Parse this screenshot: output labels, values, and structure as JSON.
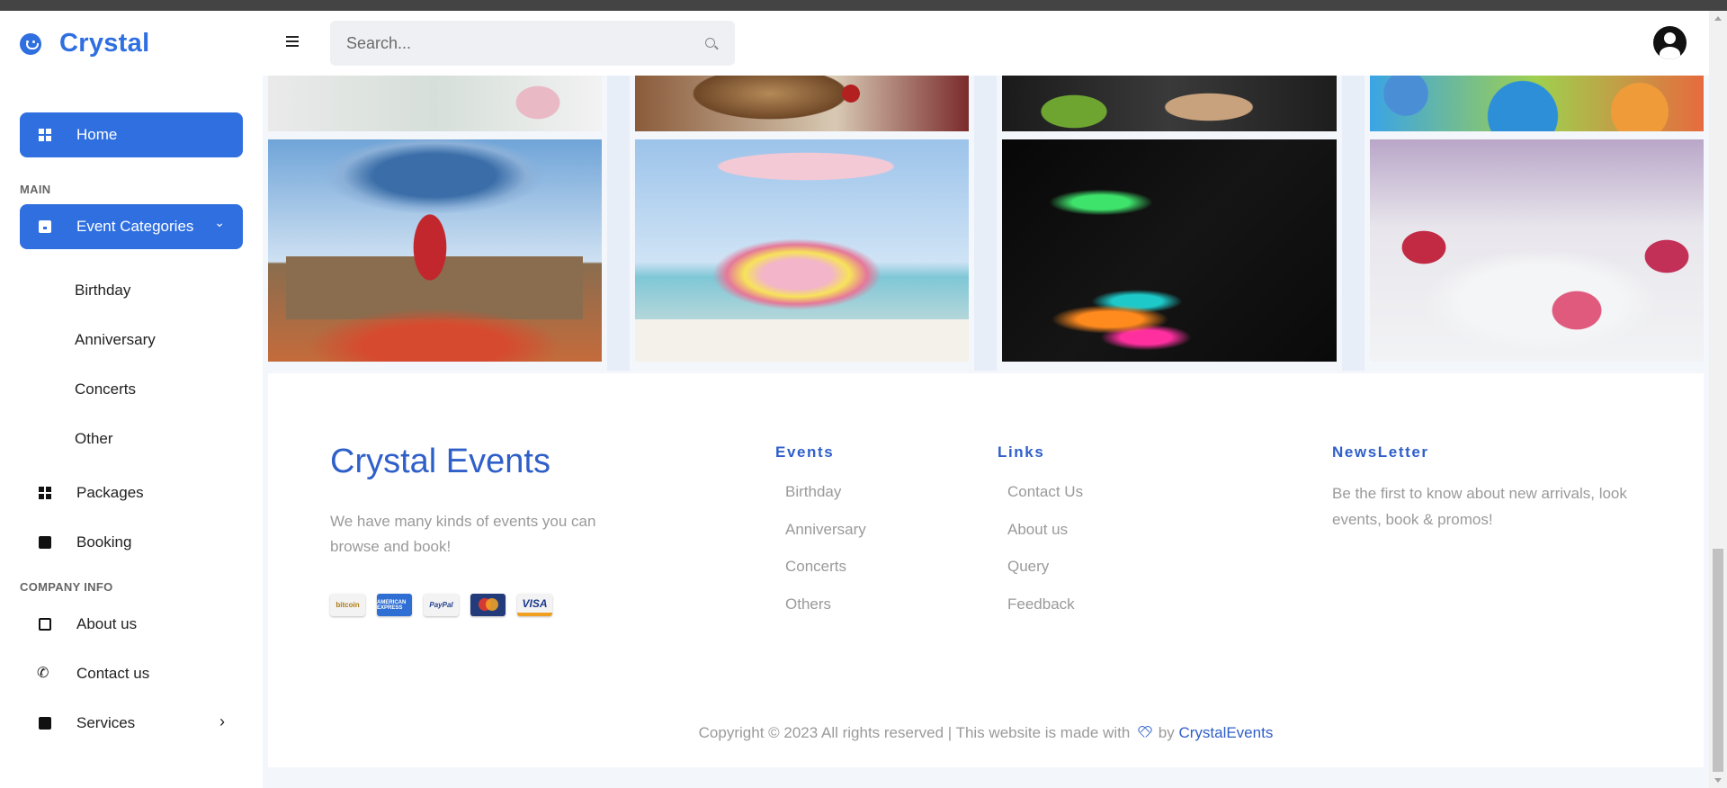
{
  "brand": {
    "name": "Crystal",
    "icon": "smile-icon",
    "color": "#2f6fe0"
  },
  "sidebar": {
    "home": {
      "label": "Home",
      "icon": "dashboard-icon"
    },
    "section_main": "MAIN",
    "event_categories": {
      "label": "Event Categories",
      "icon": "calendar-icon",
      "chevron": "⌄"
    },
    "sub_items": [
      "Birthday",
      "Anniversary",
      "Concerts",
      "Other"
    ],
    "packages": {
      "label": "Packages",
      "icon": "grid-icon"
    },
    "booking": {
      "label": "Booking",
      "icon": "chart-icon"
    },
    "section_company": "COMPANY INFO",
    "about": {
      "label": "About us",
      "icon": "info-box-icon"
    },
    "contact": {
      "label": "Contact us",
      "icon": "phone-icon"
    },
    "services": {
      "label": "Services",
      "icon": "clipboard-icon",
      "chevron": "›"
    }
  },
  "header": {
    "search_placeholder": "Search...",
    "search_value": ""
  },
  "footer": {
    "title": "Crystal Events",
    "description": "We have many kinds of events you can browse and book!",
    "payments": [
      "bitcoin",
      "AMERICAN EXPRESS",
      "PayPal",
      "MasterCard",
      "VISA"
    ],
    "events_heading": "Events",
    "events_links": [
      "Birthday",
      "Anniversary",
      "Concerts",
      "Others"
    ],
    "links_heading": "Links",
    "links": [
      "Contact Us",
      "About us",
      "Query",
      "Feedback"
    ],
    "newsletter_heading": "NewsLetter",
    "newsletter_text": "Be the first to know about new arrivals, look events, book & promos!",
    "copyright_prefix": "Copyright © 2023 All rights reserved | This website is made with",
    "copyright_by": "by",
    "copyright_brand": "CrystalEvents"
  }
}
